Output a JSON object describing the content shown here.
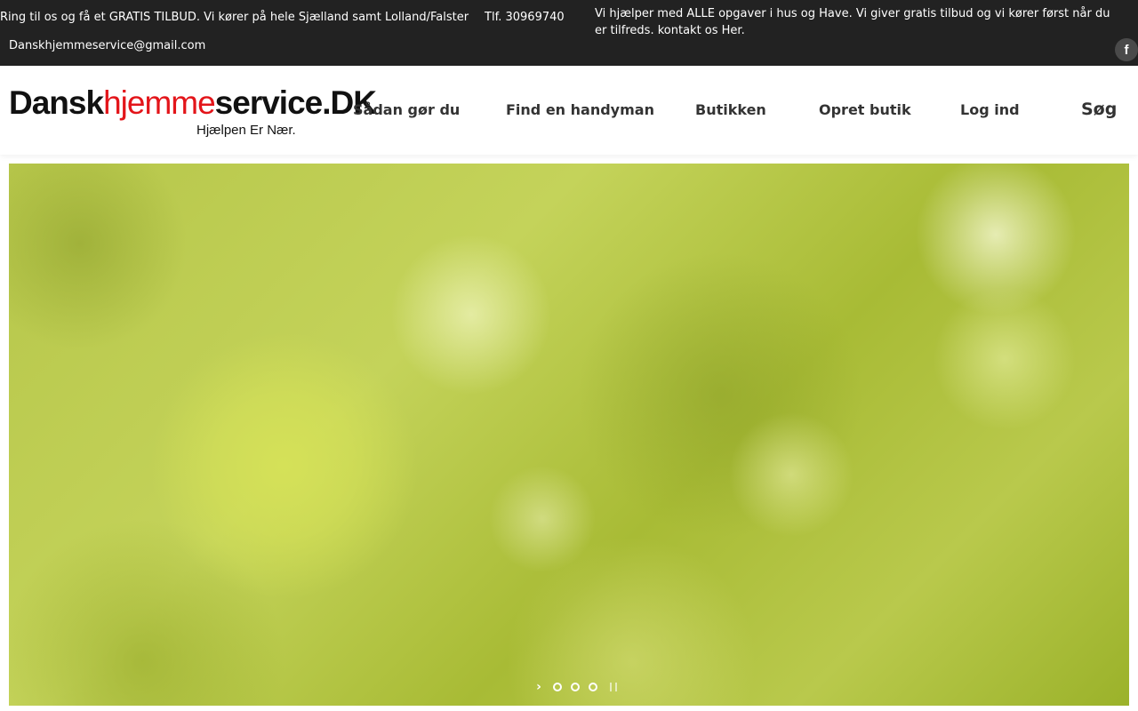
{
  "topbar": {
    "offer_text": "Ring til os og få et GRATIS TILBUD. Vi kører på hele Sjælland samt Lolland/Falster",
    "phone": "Tlf. 30969740",
    "email": "Danskhjemmeservice@gmail.com",
    "info_text": "Vi hjælper med ALLE opgaver i hus og Have. Vi giver gratis tilbud og vi kører først når du er tilfreds. kontakt os Her.",
    "facebook_glyph": "f"
  },
  "logo": {
    "part1": "Dansk",
    "part2": "hjemme",
    "part3": "service.DK",
    "tagline": "Hjælpen Er Nær.",
    "accent_color": "#e3151a"
  },
  "nav": {
    "items": [
      {
        "label": "Sådan gør du"
      },
      {
        "label": "Find en handyman"
      },
      {
        "label": "Butikken"
      },
      {
        "label": "Opret butik"
      },
      {
        "label": "Log ind"
      }
    ],
    "search_label": "Søg"
  },
  "hero": {
    "slide_count": 3,
    "controls": {
      "next_glyph": "›"
    }
  },
  "icons": [
    "facebook-icon",
    "chevron-right-icon",
    "pause-icon"
  ]
}
